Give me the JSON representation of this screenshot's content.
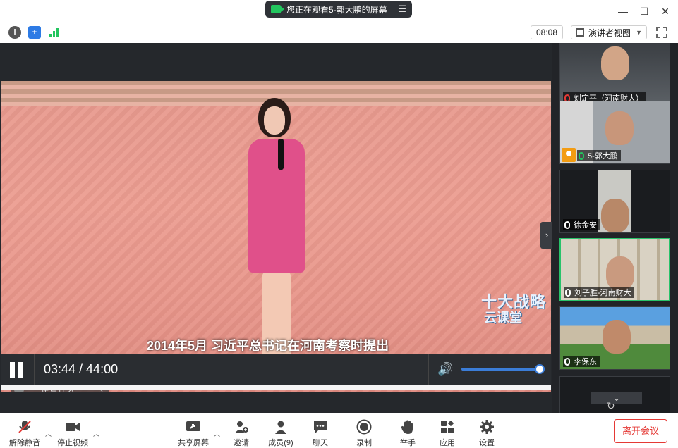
{
  "titlebar": {
    "share_banner": "您正在观看5-郭大鹏的屏幕",
    "minimize_label": "—",
    "maximize_label": "☐",
    "close_label": "✕"
  },
  "infobar": {
    "time": "08:08",
    "view_mode": "演讲者视图"
  },
  "video": {
    "logo_line1": "十大战略",
    "logo_line2": "云课堂",
    "subtitle": "2014年5月 习近平总书记在河南考察时提出",
    "chat_placeholder": "说点什么...",
    "current_time": "03:44 / 44:00",
    "playback_progress": 0.085,
    "volume_level": 0.95
  },
  "participants": [
    {
      "name": "刘定平（河南财大）",
      "mic": "muted"
    },
    {
      "name": "5-郭大鹏",
      "mic": "on",
      "host": true
    },
    {
      "name": "徐金安",
      "mic": "on"
    },
    {
      "name": "刘子胜-河南财大",
      "mic": "on",
      "active": true
    },
    {
      "name": "李保东",
      "mic": "on"
    }
  ],
  "panel": {
    "more_label": "⌄"
  },
  "toolbar": {
    "unmute": "解除静音",
    "stop_video": "停止视频",
    "share_screen": "共享屏幕",
    "invite": "邀请",
    "members": "成员(9)",
    "chat": "聊天",
    "record": "录制",
    "raise_hand": "举手",
    "apps": "应用",
    "settings": "设置",
    "leave": "离开会议"
  },
  "colors": {
    "accent": "#3b7dd8",
    "leave": "#e53935",
    "active_speaker": "#28c36a",
    "host": "#f39c12"
  }
}
